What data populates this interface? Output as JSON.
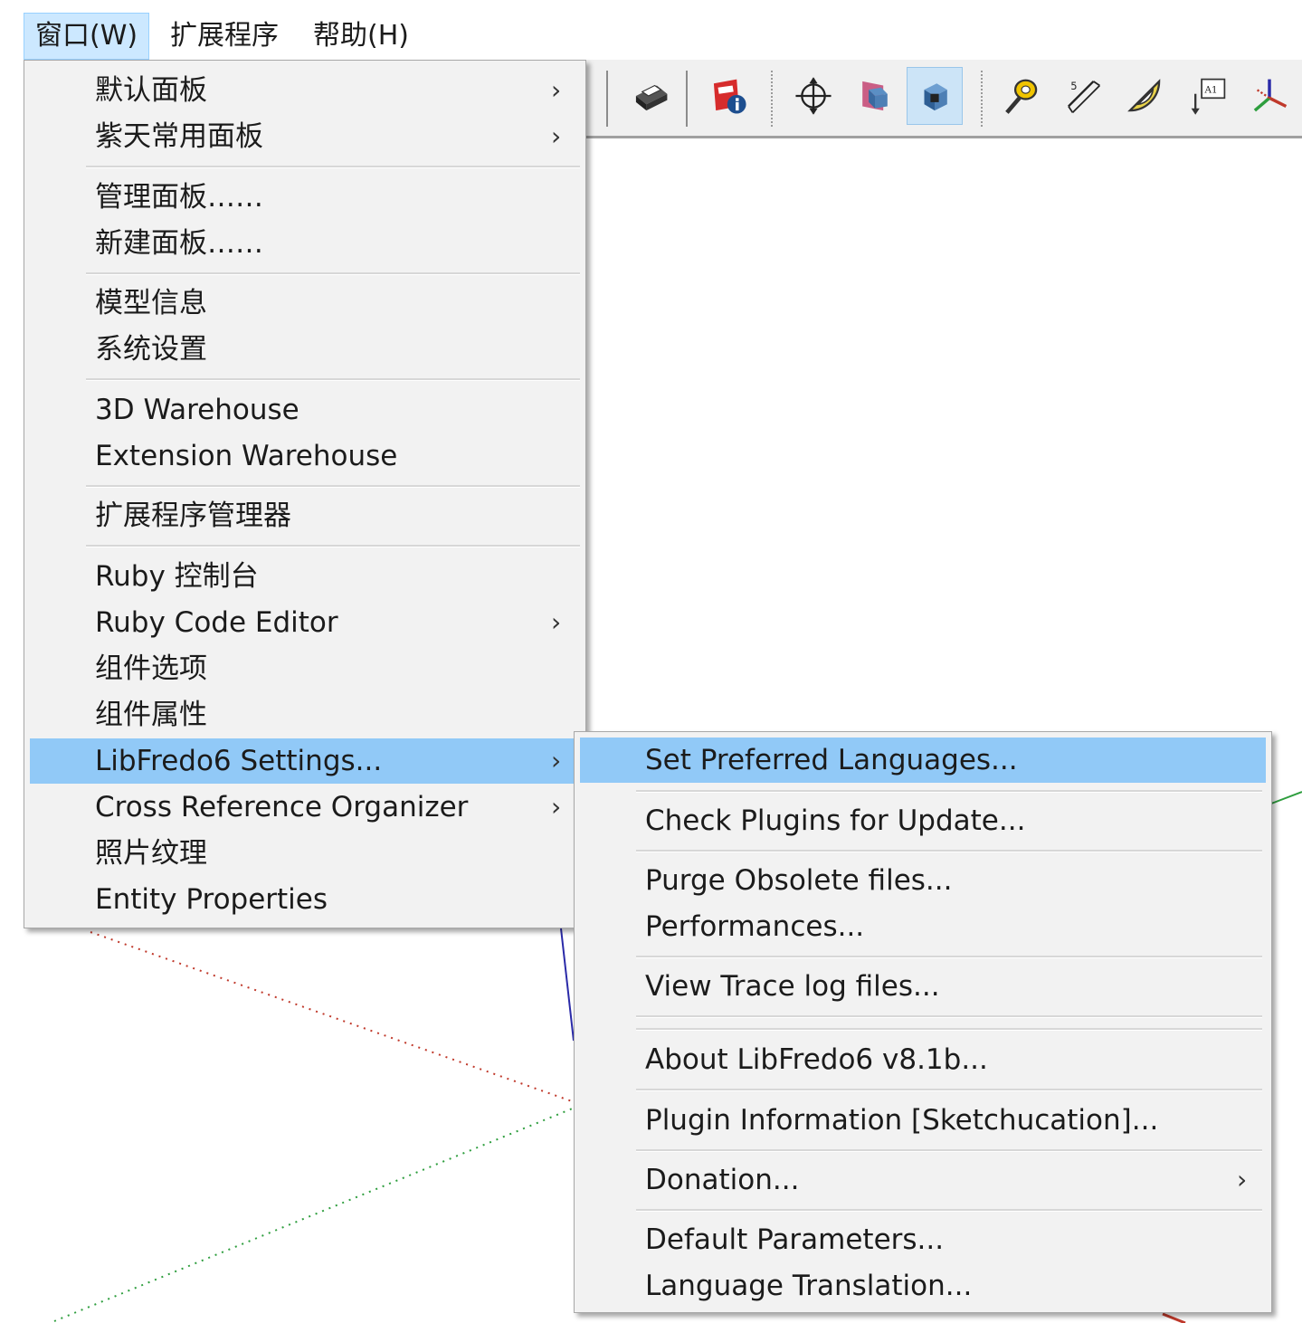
{
  "menubar": {
    "items": [
      {
        "label": "窗口(W)",
        "active": true
      },
      {
        "label": "扩展程序",
        "active": false
      },
      {
        "label": "帮助(H)",
        "active": false
      }
    ]
  },
  "toolbar": {
    "icons": [
      "print-icon",
      "model-info-icon",
      "orbit-icon",
      "section-plane-icon",
      "section-cut-icon",
      "tape-measure-icon",
      "dimension-icon",
      "protractor-icon",
      "text-label-icon",
      "axes-icon"
    ],
    "text_icon_glyph": "A1",
    "pressed_icon": "section-cut-icon"
  },
  "window_menu": {
    "items": [
      {
        "label": "默认面板",
        "submenu": true
      },
      {
        "label": "紫天常用面板",
        "submenu": true
      },
      {
        "label": "管理面板……",
        "submenu": false
      },
      {
        "label": "新建面板……",
        "submenu": false
      },
      {
        "label": "模型信息",
        "submenu": false
      },
      {
        "label": "系统设置",
        "submenu": false
      },
      {
        "label": "3D Warehouse",
        "submenu": false
      },
      {
        "label": "Extension Warehouse",
        "submenu": false
      },
      {
        "label": "扩展程序管理器",
        "submenu": false
      },
      {
        "label": "Ruby 控制台",
        "submenu": false
      },
      {
        "label": "Ruby Code Editor",
        "submenu": true
      },
      {
        "label": "组件选项",
        "submenu": false
      },
      {
        "label": "组件属性",
        "submenu": false
      },
      {
        "label": "LibFredo6 Settings...",
        "submenu": true,
        "highlighted": true
      },
      {
        "label": "Cross Reference Organizer",
        "submenu": true
      },
      {
        "label": "照片纹理",
        "submenu": false
      },
      {
        "label": "Entity Properties",
        "submenu": false
      }
    ]
  },
  "libfredo_submenu": {
    "items": [
      {
        "label": "Set Preferred Languages...",
        "submenu": false,
        "highlighted": true
      },
      {
        "label": "Check Plugins for Update...",
        "submenu": false
      },
      {
        "label": "Purge Obsolete files...",
        "submenu": false
      },
      {
        "label": "Performances...",
        "submenu": false
      },
      {
        "label": "View Trace log files...",
        "submenu": false
      },
      {
        "label": "About LibFredo6 v8.1b...",
        "submenu": false
      },
      {
        "label": "Plugin Information [Sketchucation]...",
        "submenu": false
      },
      {
        "label": "Donation...",
        "submenu": true
      },
      {
        "label": "Default Parameters...",
        "submenu": false
      },
      {
        "label": "Language Translation...",
        "submenu": false
      }
    ]
  },
  "arrow_glyph": "›",
  "colors": {
    "highlight": "#91c9f7",
    "menubar_active": "#cce8ff",
    "axis_red": "#c0392b",
    "axis_green": "#2e9e3e",
    "axis_blue": "#2a2aa8"
  }
}
